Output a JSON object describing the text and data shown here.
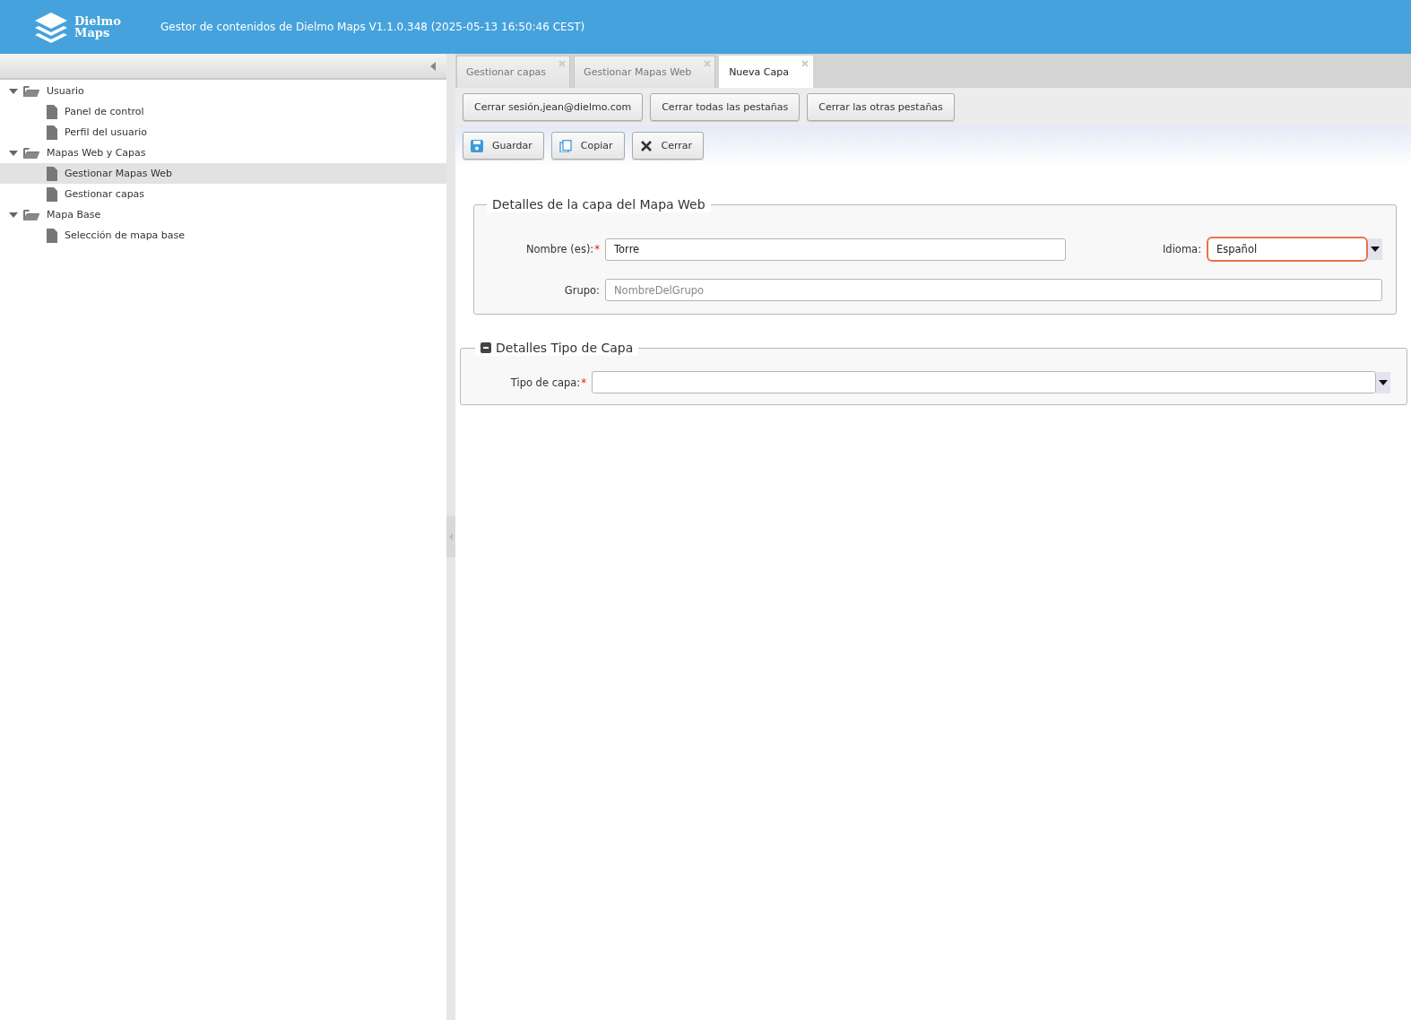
{
  "header": {
    "logo_text": [
      "Dielmo",
      "Maps"
    ],
    "title": "Gestor de contenidos de Dielmo Maps V1.1.0.348 (2025-05-13 16:50:46 CEST)"
  },
  "sidebar": {
    "tree": [
      {
        "label": "Usuario",
        "kind": "folder",
        "expanded": true,
        "selected": false,
        "children": [
          {
            "label": "Panel de control",
            "kind": "page",
            "selected": false
          },
          {
            "label": "Perfil del usuario",
            "kind": "page",
            "selected": false
          }
        ]
      },
      {
        "label": "Mapas Web y Capas",
        "kind": "folder",
        "expanded": true,
        "selected": false,
        "children": [
          {
            "label": "Gestionar Mapas Web",
            "kind": "page",
            "selected": true
          },
          {
            "label": "Gestionar capas",
            "kind": "page",
            "selected": false
          }
        ]
      },
      {
        "label": "Mapa Base",
        "kind": "folder",
        "expanded": true,
        "selected": false,
        "children": [
          {
            "label": "Selección de mapa base",
            "kind": "page",
            "selected": false
          }
        ]
      }
    ]
  },
  "tabs": [
    {
      "label": "Gestionar capas",
      "selected": false
    },
    {
      "label": "Gestionar Mapas Web",
      "selected": false
    },
    {
      "label": "Nueva Capa",
      "selected": true
    }
  ],
  "session_buttons": [
    "Cerrar sesión,jean@dielmo.com",
    "Cerrar todas las pestañas",
    "Cerrar las otras pestañas"
  ],
  "toolbar": [
    {
      "label": "Guardar",
      "kind": "save"
    },
    {
      "label": "Copiar",
      "kind": "copy"
    },
    {
      "label": "Cerrar",
      "kind": "close"
    }
  ],
  "fieldsets": [
    {
      "legend": "Detalles de la capa del Mapa Web",
      "collapsible": false,
      "rows": [
        [
          {
            "label": "Nombre (es):",
            "required_mark": "*",
            "kind": "text",
            "value": "Torre",
            "focused": false
          },
          {
            "label": "Idioma:",
            "kind": "select",
            "value": "Español",
            "focused": true
          }
        ],
        [
          {
            "label": "Grupo:",
            "kind": "text",
            "placeholder": "NombreDelGrupo",
            "focused": false
          }
        ]
      ]
    },
    {
      "legend": "Detalles Tipo de Capa",
      "collapsible": true,
      "rows": [
        [
          {
            "label": "Tipo de capa:",
            "required_mark": "*",
            "kind": "select",
            "focused": false
          }
        ]
      ]
    }
  ]
}
